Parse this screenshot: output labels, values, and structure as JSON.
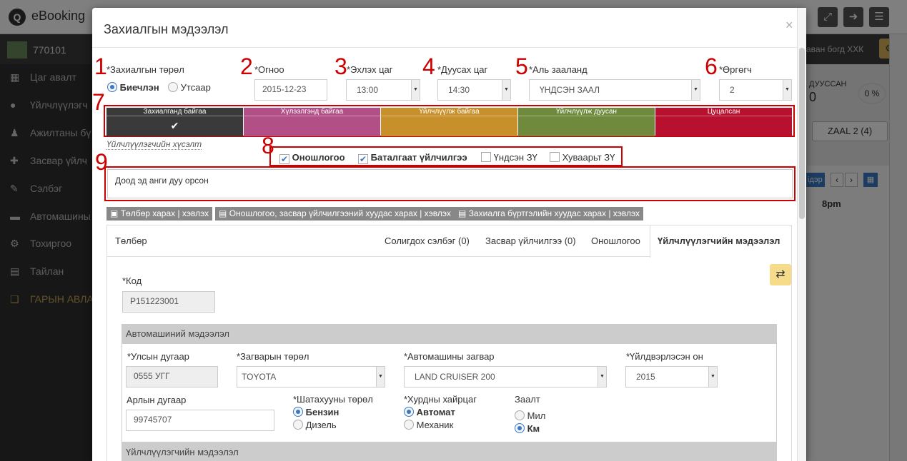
{
  "app": {
    "title": "eBooking",
    "user": "770101",
    "org": "аван богд ХХК",
    "logo_glyph": "Q"
  },
  "sidebar": {
    "items": [
      {
        "label": "Цаг авалт",
        "icon": "calendar-icon"
      },
      {
        "label": "Үйлчлүүлэгч",
        "icon": "user-icon"
      },
      {
        "label": "Ажилтаны бү",
        "icon": "users-icon"
      },
      {
        "label": "Засвар үйлч",
        "icon": "medkit-icon"
      },
      {
        "label": "Сэлбэг",
        "icon": "wrench-icon"
      },
      {
        "label": "Автомашины",
        "icon": "car-icon"
      },
      {
        "label": "Тохиргоо",
        "icon": "cogs-icon"
      },
      {
        "label": "Тайлан",
        "icon": "file-icon"
      },
      {
        "label": "ГАРЫН АВЛА",
        "icon": "book-icon"
      }
    ]
  },
  "right_panel": {
    "finished_label": "ДУУССАН",
    "finished_count": "0",
    "percent": "0 %",
    "zaal_button": "ZAAL 2 (4)",
    "cal_nav": "ідэр",
    "time_8pm": "8pm"
  },
  "modal": {
    "title": "Захиалгын мэдээлэл",
    "close": "×",
    "markers": [
      "1",
      "2",
      "3",
      "4",
      "5",
      "6",
      "7",
      "8",
      "9"
    ],
    "order_type": {
      "label": "*Захиалгын төрөл",
      "option1": "Биечлэн",
      "option2": "Утсаар",
      "selected": "Биечлэн"
    },
    "date": {
      "label": "*Огноо",
      "value": "2015-12-23"
    },
    "start_time": {
      "label": "*Эхлэх цаг",
      "value": "13:00"
    },
    "end_time": {
      "label": "*Дуусах цаг",
      "value": "14:30"
    },
    "hall": {
      "label": "*Аль зааланд",
      "value": "ҮНДСЭН ЗААЛ"
    },
    "count": {
      "label": "*Өргөгч",
      "value": "2"
    },
    "statuses": [
      {
        "label": "Захиалганд байгаа",
        "color": "#3a3a3a",
        "active": true
      },
      {
        "label": "Хүлээлгэнд байгаа",
        "color": "#b24f86",
        "active": false
      },
      {
        "label": "Үйлчлүүлж байгаа",
        "color": "#c8902a",
        "active": false
      },
      {
        "label": "Үйлчлүүлж дуусан",
        "color": "#6f8a3c",
        "active": false
      },
      {
        "label": "Цуцалсан",
        "color": "#b8102e",
        "active": false
      }
    ],
    "request_label": "Үйлчлүүлэгчийн хүсэлт",
    "services": [
      {
        "label": "Оношлогоо",
        "checked": true
      },
      {
        "label": "Баталгаат үйлчилгээ",
        "checked": true
      },
      {
        "label": "Үндсэн ЗҮ",
        "checked": false
      },
      {
        "label": "Хуваарьт ЗҮ",
        "checked": false
      }
    ],
    "request_text": "Доод эд анги дуу орсон",
    "print_buttons": [
      "Төлбөр харах | хэвлэх",
      "Оношлогоо, засвар үйлчилгээний хуудас харах | хэвлэх",
      "Захиалга бүртгэлийн хуудас харах | хэвлэх"
    ],
    "tabs": [
      {
        "label": "Төлбөр"
      },
      {
        "label": "Солигдох сэлбэг (0)"
      },
      {
        "label": "Засвар үйлчилгээ (0)"
      },
      {
        "label": "Оношлогоо"
      },
      {
        "label": "Үйлчлүүлэгчийн мэдээлэл",
        "active": true
      }
    ],
    "code": {
      "label": "*Код",
      "value": "P151223001"
    },
    "car_section": "Автомашиний мэдээлэл",
    "plate": {
      "label": "*Улсын дугаар",
      "value": "0555 УГГ"
    },
    "model_type": {
      "label": "*Загварын төрөл",
      "value": "TOYOTA"
    },
    "car_model": {
      "label": "*Автомашины загвар",
      "value": "LAND CRUISER 200"
    },
    "year": {
      "label": "*Үйлдвэрлэсэн он",
      "value": "2015"
    },
    "vin": {
      "label": "Арлын дугаар",
      "value": "99745707"
    },
    "fuel": {
      "label": "*Шатахууны төрөл",
      "option1": "Бензин",
      "option2": "Дизель",
      "selected": "Бензин"
    },
    "gearbox": {
      "label": "*Хурдны хайрцаг",
      "option1": "Автомат",
      "option2": "Механик",
      "selected": "Автомат"
    },
    "distance": {
      "label": "Заалт",
      "option1": "Мил",
      "option2": "Км",
      "selected": "Км"
    },
    "customer_section": "Үйлчлүүлэгчийн мэдээлэл"
  }
}
